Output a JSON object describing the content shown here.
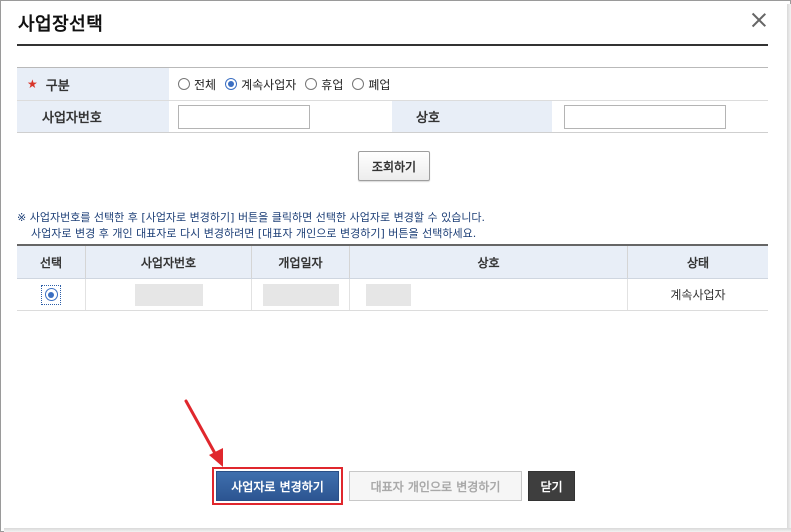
{
  "dialog": {
    "title": "사업장선택"
  },
  "search": {
    "type_label": "구분",
    "options": [
      "전체",
      "계속사업자",
      "휴업",
      "폐업"
    ],
    "selected_index": 1,
    "bizno_label": "사업자번호",
    "bizno_value": "",
    "name_label": "상호",
    "name_value": "",
    "search_button": "조회하기"
  },
  "notice": {
    "line1": "※ 사업자번호를 선택한 후 [사업자로 변경하기] 버튼을 클릭하면 선택한 사업자로 변경할 수 있습니다.",
    "line2": "사업자로 변경 후 개인 대표자로 다시 변경하려면 [대표자 개인으로 변경하기] 버튼을 선택하세요."
  },
  "table": {
    "columns": [
      "선택",
      "사업자번호",
      "개업일자",
      "상호",
      "상태"
    ],
    "rows": [
      {
        "selected": true,
        "status": "계속사업자"
      }
    ]
  },
  "buttons": {
    "change_to_business": "사업자로 변경하기",
    "change_to_representative": "대표자 개인으로 변경하기",
    "close": "닫기"
  },
  "colors": {
    "accent": "#2c5592",
    "highlight": "#e0272d",
    "header_bg": "#e8eef7"
  }
}
